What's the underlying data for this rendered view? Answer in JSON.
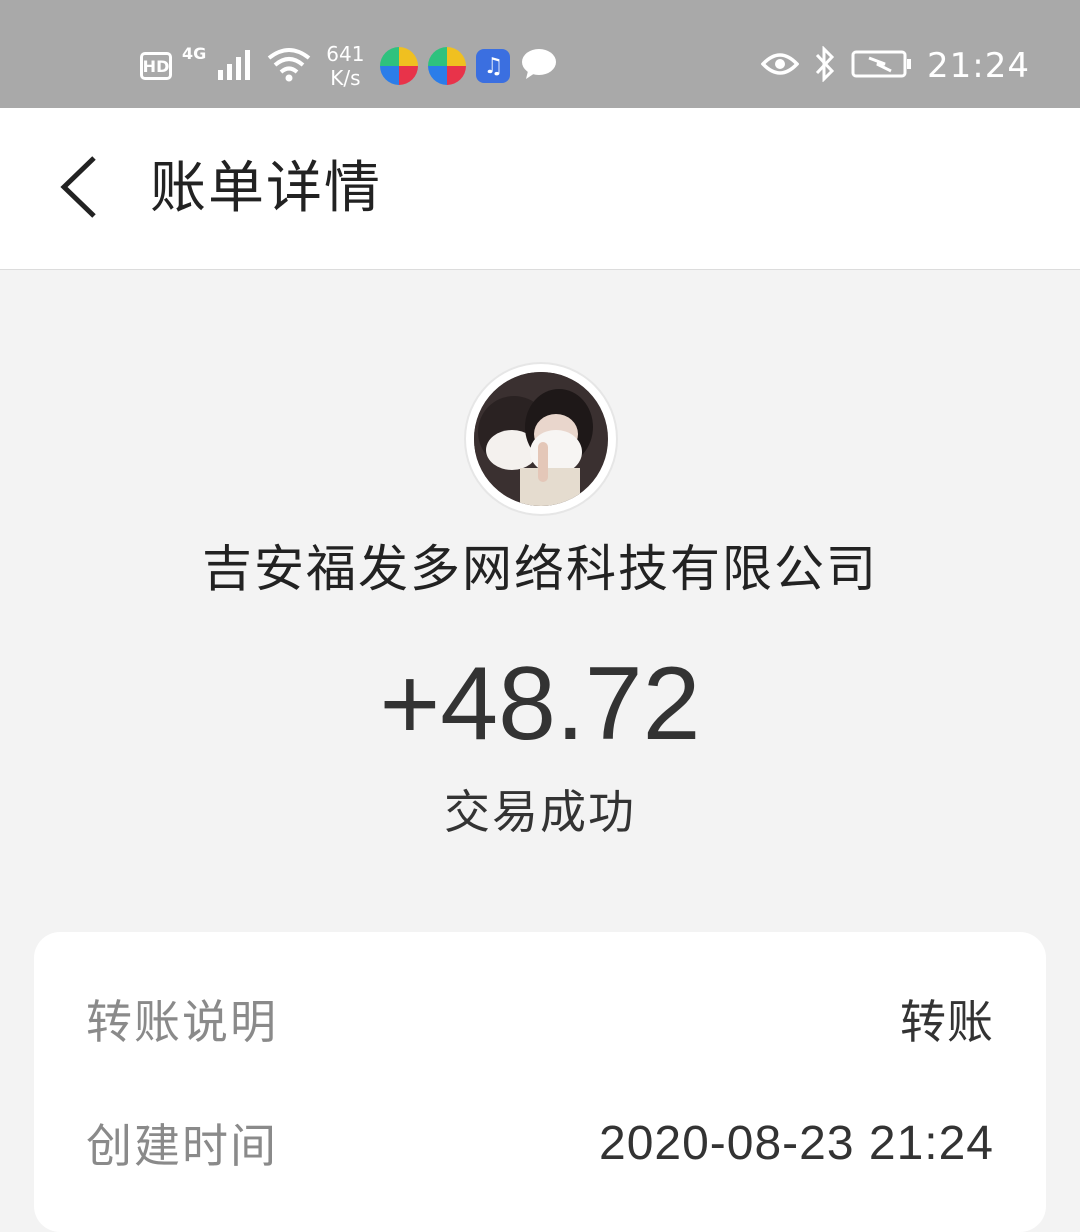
{
  "status_bar": {
    "hd": "HD",
    "network": "4G",
    "speed_value": "641",
    "speed_unit": "K/s",
    "time": "21:24",
    "icons": [
      "signal-icon",
      "wifi-icon",
      "app-icon-1",
      "app-icon-2",
      "music-app-icon",
      "message-icon",
      "eye-icon",
      "bluetooth-icon",
      "battery-icon"
    ]
  },
  "header": {
    "title": "账单详情"
  },
  "summary": {
    "merchant_name": "吉安福发多网络科技有限公司",
    "amount": "+48.72",
    "status": "交易成功"
  },
  "details": {
    "rows": [
      {
        "label": "转账说明",
        "value": "转账"
      },
      {
        "label": "创建时间",
        "value": "2020-08-23 21:24"
      }
    ]
  }
}
